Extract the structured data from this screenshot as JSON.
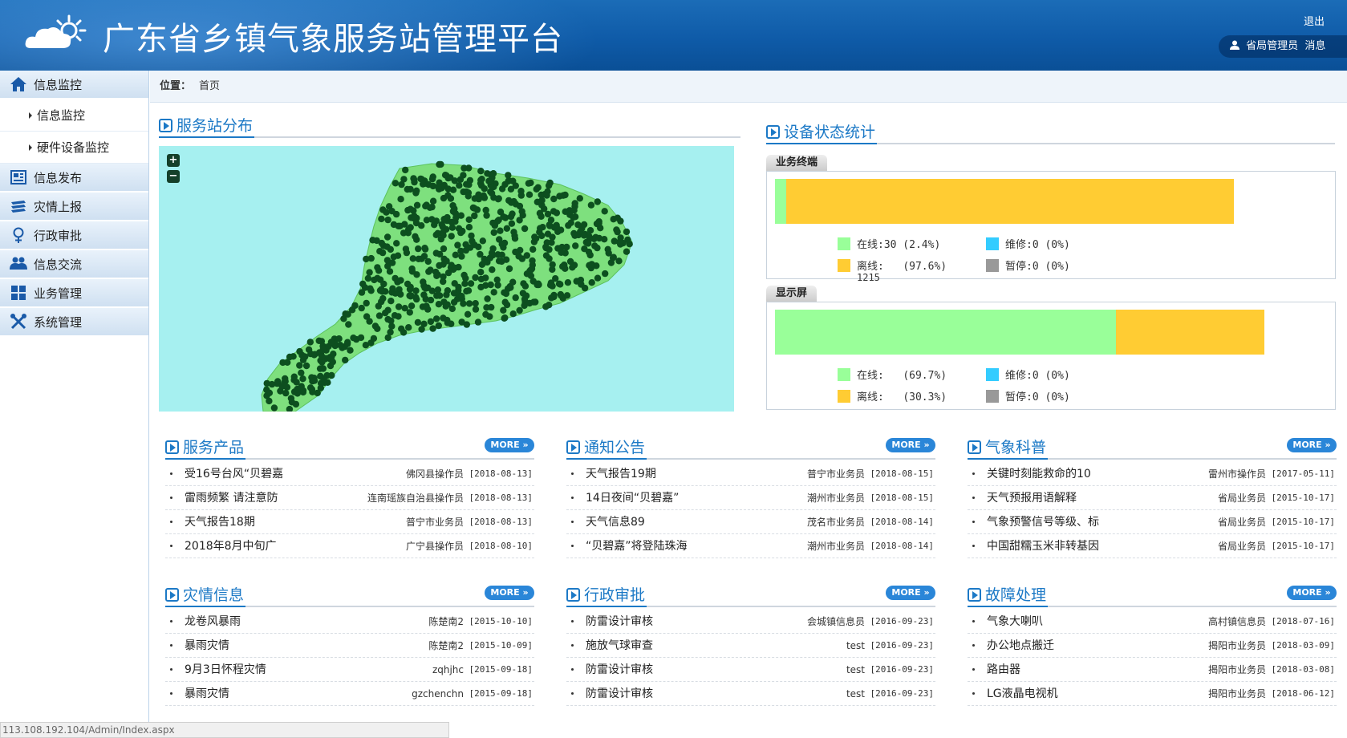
{
  "header": {
    "title": "广东省乡镇气象服务站管理平台",
    "logout": "退出",
    "user": "省局管理员",
    "messages": "消息"
  },
  "sidebar": {
    "groups": [
      {
        "label": "信息监控",
        "icon": "home-icon",
        "children": [
          "信息监控",
          "硬件设备监控"
        ]
      },
      {
        "label": "信息发布",
        "icon": "newspaper-icon"
      },
      {
        "label": "灾情上报",
        "icon": "books-icon"
      },
      {
        "label": "行政审批",
        "icon": "female-symbol-icon"
      },
      {
        "label": "信息交流",
        "icon": "users-icon"
      },
      {
        "label": "业务管理",
        "icon": "grid-icon"
      },
      {
        "label": "系统管理",
        "icon": "tools-icon"
      }
    ]
  },
  "breadcrumb": {
    "label": "位置：",
    "value": "首页"
  },
  "map_section": {
    "title": "服务站分布",
    "zoom_in": "+",
    "zoom_out": "−"
  },
  "device_section": {
    "title": "设备状态统计",
    "terminals": {
      "tab": "业务终端",
      "online_fraction": 0.024,
      "legend": {
        "online": "在线:30 (2.4%)",
        "offline_label": "离线:",
        "offline_pct": "(97.6%)",
        "offline_count": "1215",
        "repair": "维修:0  (0%)",
        "paused": "暂停:0  (0%)"
      }
    },
    "screens": {
      "tab": "显示屏",
      "online_fraction": 0.697,
      "legend": {
        "online_label": "在线:",
        "online_pct": "(69.7%)",
        "offline_label": "离线:",
        "offline_pct": "(30.3%)",
        "repair": "维修:0  (0%)",
        "paused": "暂停:0  (0%)"
      }
    },
    "colors": {
      "online": "#99ff99",
      "offline": "#ffcc33",
      "repair": "#33ccff",
      "paused": "#999999"
    }
  },
  "more_label": "MORE",
  "panels": [
    {
      "title": "服务产品",
      "items": [
        {
          "title": "受16号台风“贝碧嘉",
          "author": "佛冈县操作员",
          "date": "[2018-08-13]"
        },
        {
          "title": "雷雨频繁 请注意防",
          "author": "连南瑶族自治县操作员",
          "date": "[2018-08-13]"
        },
        {
          "title": "天气报告18期",
          "author": "普宁市业务员",
          "date": "[2018-08-13]"
        },
        {
          "title": "2018年8月中旬广",
          "author": "广宁县操作员",
          "date": "[2018-08-10]"
        }
      ]
    },
    {
      "title": "通知公告",
      "items": [
        {
          "title": "天气报告19期",
          "author": "普宁市业务员",
          "date": "[2018-08-15]"
        },
        {
          "title": "14日夜间“贝碧嘉”",
          "author": "潮州市业务员",
          "date": "[2018-08-15]"
        },
        {
          "title": "天气信息89",
          "author": "茂名市业务员",
          "date": "[2018-08-14]"
        },
        {
          "title": "“贝碧嘉”将登陆珠海",
          "author": "潮州市业务员",
          "date": "[2018-08-14]"
        }
      ]
    },
    {
      "title": "气象科普",
      "items": [
        {
          "title": "关键时刻能救命的10",
          "author": "雷州市操作员",
          "date": "[2017-05-11]"
        },
        {
          "title": "天气预报用语解释",
          "author": "省局业务员",
          "date": "[2015-10-17]"
        },
        {
          "title": "气象预警信号等级、标",
          "author": "省局业务员",
          "date": "[2015-10-17]"
        },
        {
          "title": "中国甜糯玉米非转基因",
          "author": "省局业务员",
          "date": "[2015-10-17]"
        }
      ]
    },
    {
      "title": "灾情信息",
      "items": [
        {
          "title": "龙卷风暴雨",
          "author": "陈楚南2",
          "date": "[2015-10-10]"
        },
        {
          "title": "暴雨灾情",
          "author": "陈楚南2",
          "date": "[2015-10-09]"
        },
        {
          "title": "9月3日怀程灾情",
          "author": "zqhjhc",
          "date": "[2015-09-18]"
        },
        {
          "title": "暴雨灾情",
          "author": "gzchenchn",
          "date": "[2015-09-18]"
        }
      ]
    },
    {
      "title": "行政审批",
      "items": [
        {
          "title": "防雷设计审核",
          "author": "会城镇信息员",
          "date": "[2016-09-23]"
        },
        {
          "title": "施放气球审查",
          "author": "test",
          "date": "[2016-09-23]"
        },
        {
          "title": "防雷设计审核",
          "author": "test",
          "date": "[2016-09-23]"
        },
        {
          "title": "防雷设计审核",
          "author": "test",
          "date": "[2016-09-23]"
        }
      ]
    },
    {
      "title": "故障处理",
      "items": [
        {
          "title": "气象大喇叭",
          "author": "高村镇信息员",
          "date": "[2018-07-16]"
        },
        {
          "title": "办公地点搬迁",
          "author": "揭阳市业务员",
          "date": "[2018-03-09]"
        },
        {
          "title": "路由器",
          "author": "揭阳市业务员",
          "date": "[2018-03-08]"
        },
        {
          "title": "LG液晶电视机",
          "author": "揭阳市业务员",
          "date": "[2018-06-12]"
        }
      ]
    }
  ],
  "status_url": "113.108.192.104/Admin/Index.aspx"
}
